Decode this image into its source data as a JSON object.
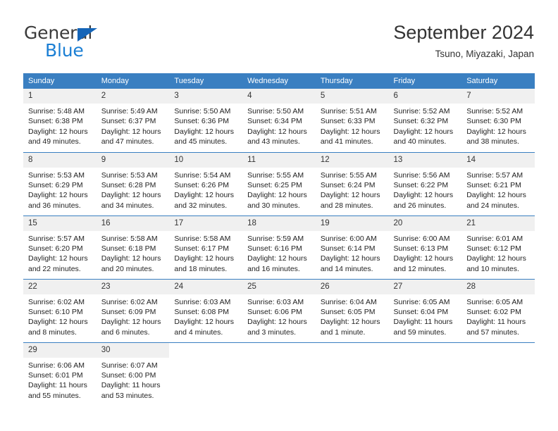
{
  "brand": {
    "name_part1": "General",
    "name_part2": "Blue",
    "flag_icon": "triangle-flag-icon"
  },
  "header": {
    "title": "September 2024",
    "subtitle": "Tsuno, Miyazaki, Japan"
  },
  "calendar": {
    "weekday_headers": [
      "Sunday",
      "Monday",
      "Tuesday",
      "Wednesday",
      "Thursday",
      "Friday",
      "Saturday"
    ],
    "accent_color": "#3a7fc1",
    "daynum_background": "#f0f0f0",
    "weeks": [
      [
        {
          "day": "1",
          "sunrise": "Sunrise: 5:48 AM",
          "sunset": "Sunset: 6:38 PM",
          "daylight": "Daylight: 12 hours and 49 minutes."
        },
        {
          "day": "2",
          "sunrise": "Sunrise: 5:49 AM",
          "sunset": "Sunset: 6:37 PM",
          "daylight": "Daylight: 12 hours and 47 minutes."
        },
        {
          "day": "3",
          "sunrise": "Sunrise: 5:50 AM",
          "sunset": "Sunset: 6:36 PM",
          "daylight": "Daylight: 12 hours and 45 minutes."
        },
        {
          "day": "4",
          "sunrise": "Sunrise: 5:50 AM",
          "sunset": "Sunset: 6:34 PM",
          "daylight": "Daylight: 12 hours and 43 minutes."
        },
        {
          "day": "5",
          "sunrise": "Sunrise: 5:51 AM",
          "sunset": "Sunset: 6:33 PM",
          "daylight": "Daylight: 12 hours and 41 minutes."
        },
        {
          "day": "6",
          "sunrise": "Sunrise: 5:52 AM",
          "sunset": "Sunset: 6:32 PM",
          "daylight": "Daylight: 12 hours and 40 minutes."
        },
        {
          "day": "7",
          "sunrise": "Sunrise: 5:52 AM",
          "sunset": "Sunset: 6:30 PM",
          "daylight": "Daylight: 12 hours and 38 minutes."
        }
      ],
      [
        {
          "day": "8",
          "sunrise": "Sunrise: 5:53 AM",
          "sunset": "Sunset: 6:29 PM",
          "daylight": "Daylight: 12 hours and 36 minutes."
        },
        {
          "day": "9",
          "sunrise": "Sunrise: 5:53 AM",
          "sunset": "Sunset: 6:28 PM",
          "daylight": "Daylight: 12 hours and 34 minutes."
        },
        {
          "day": "10",
          "sunrise": "Sunrise: 5:54 AM",
          "sunset": "Sunset: 6:26 PM",
          "daylight": "Daylight: 12 hours and 32 minutes."
        },
        {
          "day": "11",
          "sunrise": "Sunrise: 5:55 AM",
          "sunset": "Sunset: 6:25 PM",
          "daylight": "Daylight: 12 hours and 30 minutes."
        },
        {
          "day": "12",
          "sunrise": "Sunrise: 5:55 AM",
          "sunset": "Sunset: 6:24 PM",
          "daylight": "Daylight: 12 hours and 28 minutes."
        },
        {
          "day": "13",
          "sunrise": "Sunrise: 5:56 AM",
          "sunset": "Sunset: 6:22 PM",
          "daylight": "Daylight: 12 hours and 26 minutes."
        },
        {
          "day": "14",
          "sunrise": "Sunrise: 5:57 AM",
          "sunset": "Sunset: 6:21 PM",
          "daylight": "Daylight: 12 hours and 24 minutes."
        }
      ],
      [
        {
          "day": "15",
          "sunrise": "Sunrise: 5:57 AM",
          "sunset": "Sunset: 6:20 PM",
          "daylight": "Daylight: 12 hours and 22 minutes."
        },
        {
          "day": "16",
          "sunrise": "Sunrise: 5:58 AM",
          "sunset": "Sunset: 6:18 PM",
          "daylight": "Daylight: 12 hours and 20 minutes."
        },
        {
          "day": "17",
          "sunrise": "Sunrise: 5:58 AM",
          "sunset": "Sunset: 6:17 PM",
          "daylight": "Daylight: 12 hours and 18 minutes."
        },
        {
          "day": "18",
          "sunrise": "Sunrise: 5:59 AM",
          "sunset": "Sunset: 6:16 PM",
          "daylight": "Daylight: 12 hours and 16 minutes."
        },
        {
          "day": "19",
          "sunrise": "Sunrise: 6:00 AM",
          "sunset": "Sunset: 6:14 PM",
          "daylight": "Daylight: 12 hours and 14 minutes."
        },
        {
          "day": "20",
          "sunrise": "Sunrise: 6:00 AM",
          "sunset": "Sunset: 6:13 PM",
          "daylight": "Daylight: 12 hours and 12 minutes."
        },
        {
          "day": "21",
          "sunrise": "Sunrise: 6:01 AM",
          "sunset": "Sunset: 6:12 PM",
          "daylight": "Daylight: 12 hours and 10 minutes."
        }
      ],
      [
        {
          "day": "22",
          "sunrise": "Sunrise: 6:02 AM",
          "sunset": "Sunset: 6:10 PM",
          "daylight": "Daylight: 12 hours and 8 minutes."
        },
        {
          "day": "23",
          "sunrise": "Sunrise: 6:02 AM",
          "sunset": "Sunset: 6:09 PM",
          "daylight": "Daylight: 12 hours and 6 minutes."
        },
        {
          "day": "24",
          "sunrise": "Sunrise: 6:03 AM",
          "sunset": "Sunset: 6:08 PM",
          "daylight": "Daylight: 12 hours and 4 minutes."
        },
        {
          "day": "25",
          "sunrise": "Sunrise: 6:03 AM",
          "sunset": "Sunset: 6:06 PM",
          "daylight": "Daylight: 12 hours and 3 minutes."
        },
        {
          "day": "26",
          "sunrise": "Sunrise: 6:04 AM",
          "sunset": "Sunset: 6:05 PM",
          "daylight": "Daylight: 12 hours and 1 minute."
        },
        {
          "day": "27",
          "sunrise": "Sunrise: 6:05 AM",
          "sunset": "Sunset: 6:04 PM",
          "daylight": "Daylight: 11 hours and 59 minutes."
        },
        {
          "day": "28",
          "sunrise": "Sunrise: 6:05 AM",
          "sunset": "Sunset: 6:02 PM",
          "daylight": "Daylight: 11 hours and 57 minutes."
        }
      ],
      [
        {
          "day": "29",
          "sunrise": "Sunrise: 6:06 AM",
          "sunset": "Sunset: 6:01 PM",
          "daylight": "Daylight: 11 hours and 55 minutes."
        },
        {
          "day": "30",
          "sunrise": "Sunrise: 6:07 AM",
          "sunset": "Sunset: 6:00 PM",
          "daylight": "Daylight: 11 hours and 53 minutes."
        },
        {
          "day": "",
          "sunrise": "",
          "sunset": "",
          "daylight": ""
        },
        {
          "day": "",
          "sunrise": "",
          "sunset": "",
          "daylight": ""
        },
        {
          "day": "",
          "sunrise": "",
          "sunset": "",
          "daylight": ""
        },
        {
          "day": "",
          "sunrise": "",
          "sunset": "",
          "daylight": ""
        },
        {
          "day": "",
          "sunrise": "",
          "sunset": "",
          "daylight": ""
        }
      ]
    ]
  }
}
